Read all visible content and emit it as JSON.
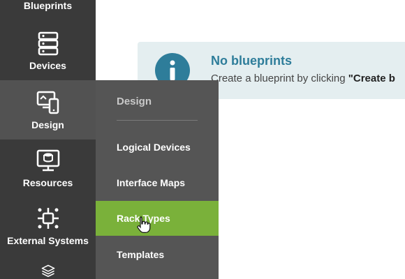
{
  "sidebar": {
    "items": [
      {
        "label": "Blueprints",
        "icon": "blueprints-icon"
      },
      {
        "label": "Devices",
        "icon": "server-rack-icon"
      },
      {
        "label": "Design",
        "icon": "design-devices-icon",
        "active": true
      },
      {
        "label": "Resources",
        "icon": "resources-monitor-icon"
      },
      {
        "label": "External Systems",
        "icon": "external-systems-icon"
      },
      {
        "label": "",
        "icon": "layers-icon"
      }
    ]
  },
  "flyout": {
    "header": "Design",
    "items": [
      {
        "label": "Logical Devices"
      },
      {
        "label": "Interface Maps"
      },
      {
        "label": "Rack Types",
        "selected": true
      },
      {
        "label": "Templates"
      }
    ]
  },
  "banner": {
    "title": "No blueprints",
    "text_prefix": "Create a blueprint by clicking ",
    "text_emphasis": "\"Create b"
  },
  "colors": {
    "sidebar_bg": "#3a3a3a",
    "sidebar_active_bg": "#525252",
    "flyout_bg": "#555555",
    "selected_green": "#7ab13a",
    "banner_bg": "#e4eef0",
    "info_teal": "#2e7d9a"
  }
}
